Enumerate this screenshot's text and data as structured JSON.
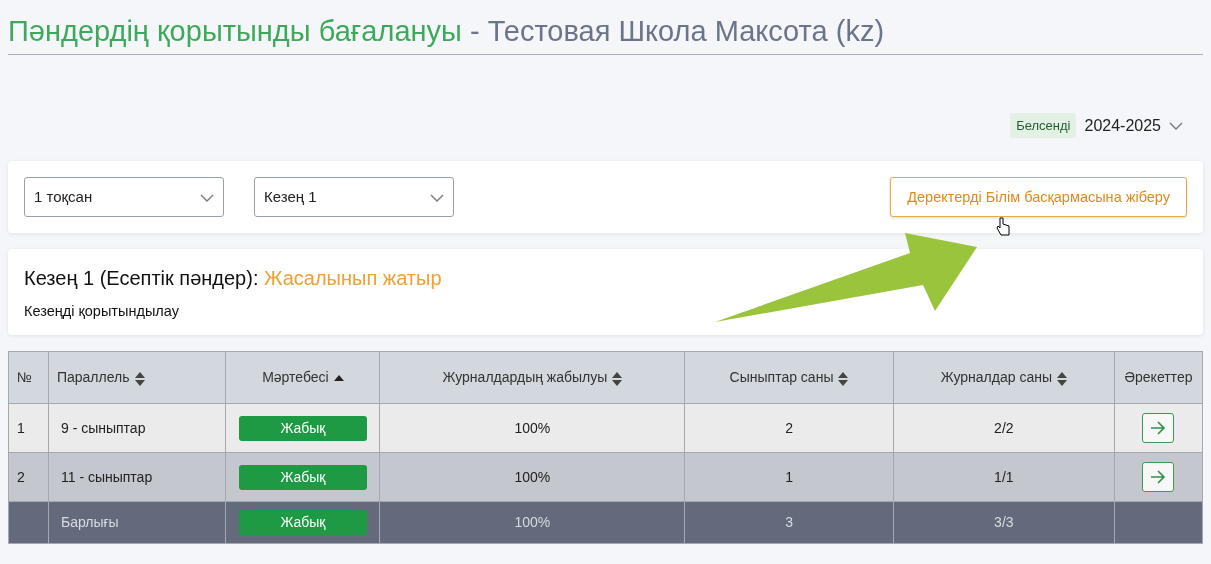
{
  "header": {
    "title": "Пәндердің қорытынды бағалануы",
    "separator": "-",
    "school": "Тестовая Школа Максота (kz)"
  },
  "year_selector": {
    "badge": "Белсенді",
    "value": "2024-2025"
  },
  "filters": [
    {
      "value": "1 тоқсан"
    },
    {
      "value": "Кезең 1"
    }
  ],
  "send_button": {
    "label": "Деректерді Білім басқармасына жіберу"
  },
  "period": {
    "title": "Кезең 1 (Есептік пәндер):",
    "status": "Жасалынып жатыр",
    "subtitle": "Кезеңді қорытындылау"
  },
  "table": {
    "columns": [
      {
        "label": "№",
        "sortable": false
      },
      {
        "label": "Параллель",
        "sortable": true,
        "sorted": false
      },
      {
        "label": "Мәртебесі",
        "sortable": true,
        "sorted": true
      },
      {
        "label": "Журналдардың жабылуы",
        "sortable": true,
        "sorted": false
      },
      {
        "label": "Сыныптар саны",
        "sortable": true,
        "sorted": false
      },
      {
        "label": "Журналдар саны",
        "sortable": true,
        "sorted": false
      },
      {
        "label": "Әрекеттер",
        "sortable": false
      }
    ],
    "rows": [
      {
        "number": "1",
        "parallel": "9 - сыныптар",
        "status": "Жабық",
        "closure": "100%",
        "classes": "2",
        "journals": "2/2",
        "kind": "row"
      },
      {
        "number": "2",
        "parallel": "11 - сыныптар",
        "status": "Жабық",
        "closure": "100%",
        "classes": "1",
        "journals": "1/1",
        "kind": "row"
      },
      {
        "parallel": "Барлығы",
        "status": "Жабық",
        "closure": "100%",
        "classes": "3",
        "journals": "3/3",
        "kind": "total"
      }
    ]
  }
}
